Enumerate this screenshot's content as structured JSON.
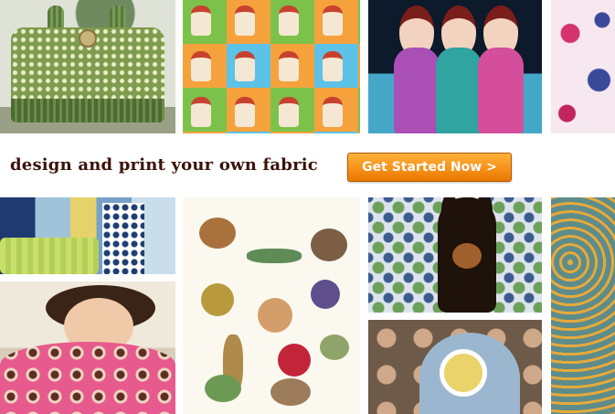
{
  "banner": {
    "tagline": "design and print your own fabric",
    "cta_label": "Get Started Now >"
  },
  "colors": {
    "tagline": "#3a1308",
    "cta_top": "#ffb23a",
    "cta_bottom": "#e97800"
  }
}
